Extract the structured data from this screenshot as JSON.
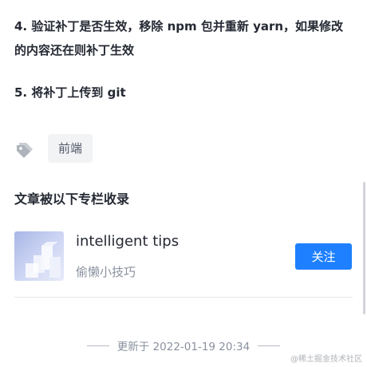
{
  "article": {
    "step4": "4. 验证补丁是否生效，移除 npm 包并重新 yarn，如果修改的内容还在则补丁生效",
    "step5": "5. 将补丁上传到 git"
  },
  "tags": [
    {
      "icon": "tag-icon",
      "label": "前端"
    }
  ],
  "columns": {
    "section_title": "文章被以下专栏收录",
    "items": [
      {
        "name": "intelligent tips",
        "subtitle": "偷懒小技巧",
        "follow_label": "关注"
      }
    ]
  },
  "footer": {
    "updated": "更新于 2022-01-19 20:34"
  },
  "watermark": "@稀土掘金技术社区",
  "colors": {
    "accent": "#1e80ff",
    "text_primary": "#252933",
    "text_secondary": "#8a919f",
    "chip_bg": "#f2f3f5"
  }
}
